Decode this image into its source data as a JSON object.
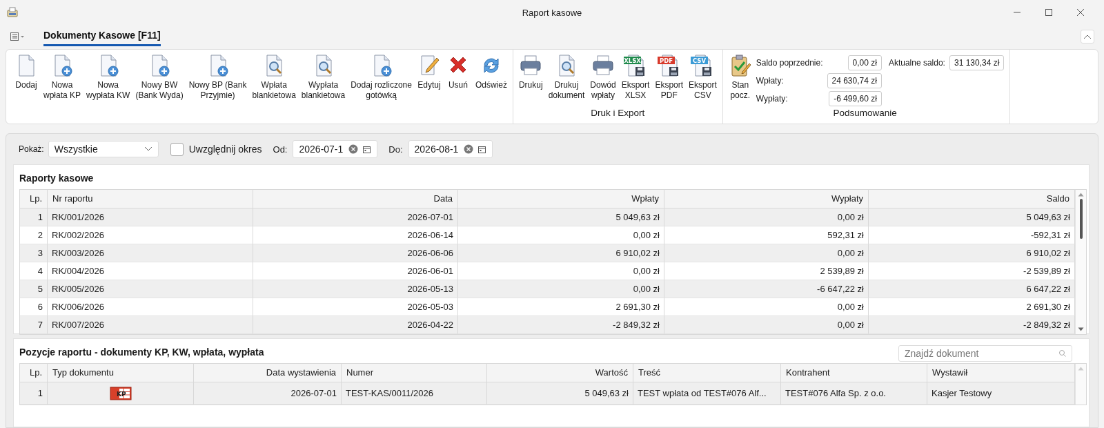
{
  "window": {
    "title": "Raport kasowe"
  },
  "tabs": [
    {
      "label": "Dokumenty Kasowe [F11]",
      "selected": true
    }
  ],
  "ribbon": {
    "groups": [
      {
        "buttons": [
          {
            "kind": "doc",
            "lines": [
              "Dodaj"
            ]
          },
          {
            "kind": "doc-plus",
            "lines": [
              "Nowa",
              "wpłata KP"
            ]
          },
          {
            "kind": "doc-plus",
            "lines": [
              "Nowa",
              "wypłata KW"
            ]
          },
          {
            "kind": "doc-plus",
            "lines": [
              "Nowy BW",
              "(Bank Wyda)"
            ]
          },
          {
            "kind": "doc-plus",
            "lines": [
              "Nowy BP (Bank",
              "Przyjmie)"
            ]
          },
          {
            "kind": "doc-search",
            "lines": [
              "Wpłata",
              "blankietowa"
            ]
          },
          {
            "kind": "doc-search",
            "lines": [
              "Wypłata",
              "blankietowa"
            ]
          },
          {
            "kind": "doc-plus",
            "lines": [
              "Dodaj rozliczone",
              "gotówką"
            ]
          },
          {
            "kind": "edit",
            "lines": [
              "Edytuj"
            ]
          },
          {
            "kind": "delete",
            "lines": [
              "Usuń"
            ]
          },
          {
            "kind": "refresh",
            "lines": [
              "Odśwież"
            ]
          }
        ]
      },
      {
        "label": "Druk i Export",
        "buttons": [
          {
            "kind": "print",
            "lines": [
              "Drukuj"
            ]
          },
          {
            "kind": "doc-search",
            "lines": [
              "Drukuj",
              "dokument"
            ]
          },
          {
            "kind": "print",
            "lines": [
              "Dowód",
              "wpłaty"
            ]
          },
          {
            "kind": "export",
            "badge": "XLSX",
            "color": "#1e8a4c",
            "lines": [
              "Eksport",
              "XLSX"
            ]
          },
          {
            "kind": "export",
            "badge": "PDF",
            "color": "#d83a2c",
            "lines": [
              "Eksport",
              "PDF"
            ]
          },
          {
            "kind": "export",
            "badge": "CSV",
            "color": "#3b9bd6",
            "lines": [
              "Eksport",
              "CSV"
            ]
          }
        ]
      },
      {
        "label": "Podsumowanie",
        "buttons": [
          {
            "kind": "clipboard",
            "lines": [
              "Stan",
              "pocz."
            ]
          }
        ],
        "summary": [
          {
            "label": "Saldo poprzednie:",
            "value": "0,00 zł"
          },
          {
            "label": "Aktualne saldo:",
            "value": "31 130,34 zł"
          },
          {
            "label": "Wpłaty:",
            "value": "24 630,74 zł"
          },
          {
            "label": "Wypłaty:",
            "value": "-6 499,60 zł"
          }
        ]
      }
    ]
  },
  "filter": {
    "show_label": "Pokaż:",
    "show_value": "Wszystkie",
    "period": {
      "label": "Uwzględnij okres",
      "checked": false
    },
    "from": {
      "label": "Od:",
      "value": "2026-07-1"
    },
    "to": {
      "label": "Do:",
      "value": "2026-08-1"
    }
  },
  "reports": {
    "title": "Raporty kasowe",
    "columns": [
      "Lp.",
      "Nr raportu",
      "Data",
      "Wpłaty",
      "Wypłaty",
      "Saldo"
    ],
    "rows": [
      [
        "1",
        "RK/001/2026",
        "2026-07-01",
        "5 049,63 zł",
        "0,00 zł",
        "5 049,63 zł"
      ],
      [
        "2",
        "RK/002/2026",
        "2026-06-14",
        "0,00 zł",
        "592,31 zł",
        "-592,31 zł"
      ],
      [
        "3",
        "RK/003/2026",
        "2026-06-06",
        "6 910,02 zł",
        "0,00 zł",
        "6 910,02 zł"
      ],
      [
        "4",
        "RK/004/2026",
        "2026-06-01",
        "0,00 zł",
        "2 539,89 zł",
        "-2 539,89 zł"
      ],
      [
        "5",
        "RK/005/2026",
        "2026-05-13",
        "0,00 zł",
        "-6 647,22 zł",
        "6 647,22 zł"
      ],
      [
        "6",
        "RK/006/2026",
        "2026-05-03",
        "2 691,30 zł",
        "0,00 zł",
        "2 691,30 zł"
      ],
      [
        "7",
        "RK/007/2026",
        "2026-04-22",
        "-2 849,32 zł",
        "0,00 zł",
        "-2 849,32 zł"
      ]
    ]
  },
  "items": {
    "title": "Pozycje raportu - dokumenty KP, KW, wpłata, wypłata",
    "search": {
      "placeholder": "Znajdź dokument"
    },
    "columns": [
      "Lp.",
      "Typ dokumentu",
      "Data wystawienia",
      "Numer",
      "Wartość",
      "Treść",
      "Kontrahent",
      "Wystawił"
    ],
    "rows": [
      {
        "lp": "1",
        "type_badge": "KP",
        "date": "2026-07-01",
        "number": "TEST-KAS/0011/2026",
        "value": "5 049,63 zł",
        "content": "TEST wpłata od TEST#076 Alf...",
        "contractor": "TEST#076 Alfa Sp. z o.o.",
        "issuer": "Kasjer Testowy"
      }
    ]
  }
}
